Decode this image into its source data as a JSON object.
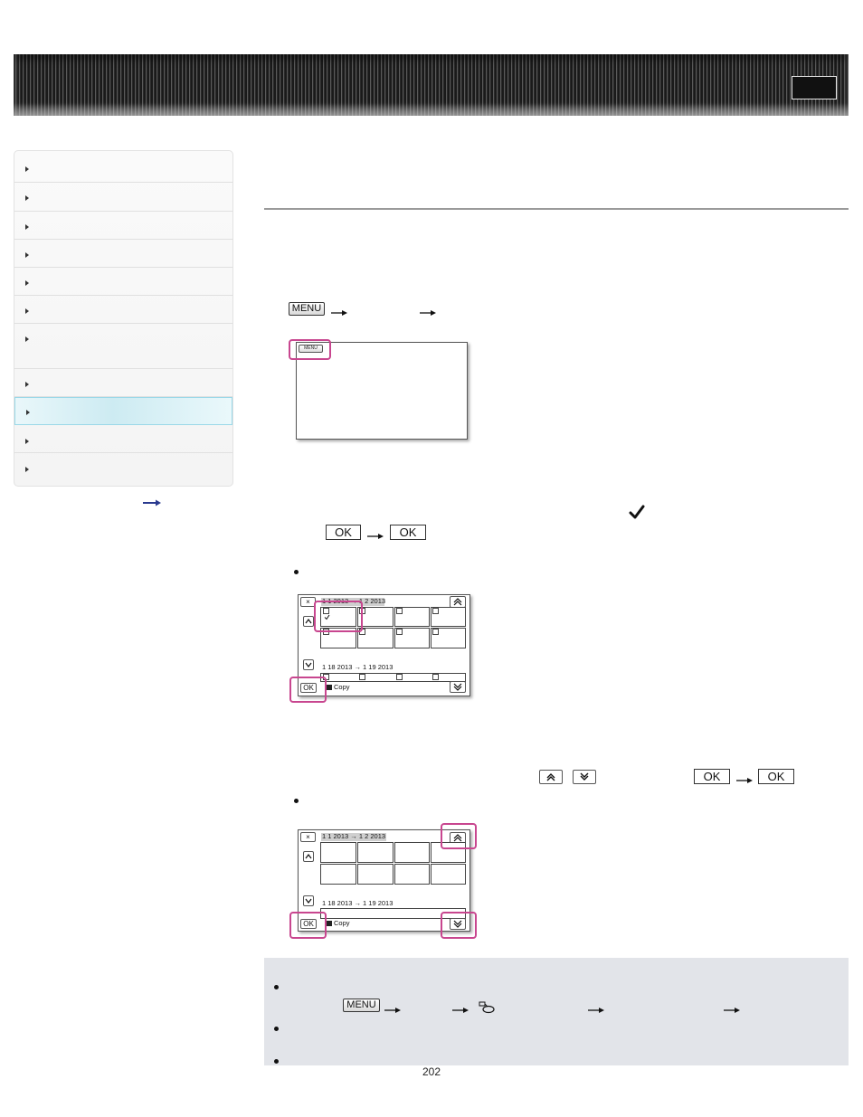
{
  "page": {
    "number": "202"
  },
  "header": {
    "icon_color": "#111111"
  },
  "sidebar": {
    "items": [
      {
        "label": ""
      },
      {
        "label": ""
      },
      {
        "label": ""
      },
      {
        "label": ""
      },
      {
        "label": ""
      },
      {
        "label": ""
      },
      {
        "label": ""
      },
      {
        "label": ""
      },
      {
        "label": "",
        "active": true
      },
      {
        "label": ""
      },
      {
        "label": ""
      }
    ],
    "active_color": "#cdebf2"
  },
  "steps": {
    "step1": {
      "menu_label": "MENU"
    },
    "screen1": {
      "menu_label": "MENU"
    },
    "step2": {
      "ok1": "OK",
      "ok2": "OK"
    },
    "screen2": {
      "date_top": "1 1 2013 → 1 2 2013",
      "date_bottom": "1 18 2013 → 1 19 2013",
      "close": "×",
      "ok": "OK",
      "copy": "Copy"
    },
    "step3": {
      "ok1": "OK",
      "ok2": "OK"
    },
    "screen3": {
      "date_top": "1 1 2013 → 1 2 2013",
      "date_bottom": "1 18 2013 → 1 19 2013",
      "close": "×",
      "ok": "OK",
      "copy": "Copy"
    }
  },
  "notes": {
    "menu_label": "MENU"
  },
  "colors": {
    "highlight": "#c8468f",
    "note_bg": "#e2e4e9",
    "rule": "#9a9a9a"
  }
}
